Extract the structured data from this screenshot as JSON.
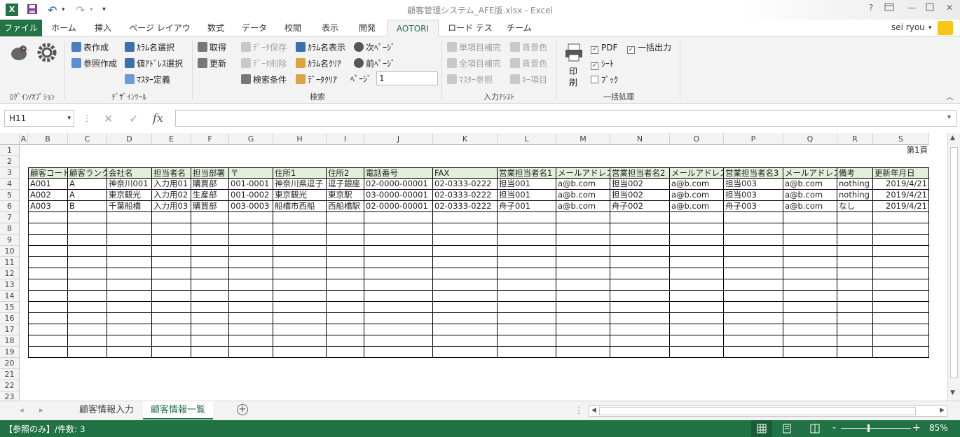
{
  "window": {
    "title": "顧客管理システム_AFE版.xlsx - Excel",
    "help": "?",
    "qat_more": "▾"
  },
  "tabs": [
    "ファイル",
    "ホーム",
    "挿入",
    "ページ レイアウト",
    "数式",
    "データ",
    "校閲",
    "表示",
    "開発",
    "AOTORI",
    "ロード テスト",
    "チーム"
  ],
  "user": "sei ryou",
  "ribbon": {
    "groups": {
      "login": "ﾛｸﾞｲﾝ/ｵﾌﾟｼｮﾝ",
      "design": "ﾃﾞｻﾞｲﾝﾂｰﾙ",
      "search": "検索",
      "assist": "入力ｱｼｽﾄ",
      "batch": "一括処理"
    },
    "design": [
      "表作成",
      "参照作成",
      "ｶﾗﾑ名選択",
      "値ｱﾄﾞﾚｽ選択",
      "ﾏｽﾀｰ定義"
    ],
    "search": [
      "取得",
      "更新",
      "ﾃﾞｰﾀ保存",
      "ﾃﾞｰﾀ削除",
      "検索条件",
      "ｶﾗﾑ名表示",
      "ｶﾗﾑ名ｸﾘｱ",
      "ﾃﾞｰﾀｸﾘｱ",
      "次ﾍﾟｰｼﾞ",
      "前ﾍﾟｰｼﾞ"
    ],
    "page_label": "ﾍﾟｰｼﾞ",
    "page_value": "1",
    "assist": [
      "単項目補完",
      "全項目補完",
      "ﾏｽﾀｰ参照",
      "背景色",
      "背景色",
      "ｷｰ項目"
    ],
    "batch": {
      "print": "印刷",
      "pdf": "PDF",
      "bulk": "一括出力",
      "sheet": "ｼｰﾄ",
      "book": "ﾌﾞｯｸ"
    }
  },
  "formula_bar": {
    "name_box": "H11",
    "fx": "fx",
    "value": ""
  },
  "columns": [
    "A",
    "B",
    "C",
    "D",
    "E",
    "F",
    "G",
    "H",
    "I",
    "J",
    "K",
    "L",
    "M",
    "N",
    "O",
    "P",
    "Q",
    "R",
    "S"
  ],
  "page_label_cell": "第1頁",
  "table": {
    "headers": [
      "顧客コード",
      "顧客ランク",
      "会社名",
      "担当者名",
      "担当部署",
      "〒",
      "住所1",
      "住所2",
      "電話番号",
      "FAX",
      "営業担当者名1",
      "メールアドレス1",
      "営業担当者名2",
      "メールアドレス2",
      "営業担当者名3",
      "メールアドレス3",
      "備考",
      "更新年月日"
    ],
    "rows": [
      [
        "A001",
        "A",
        "神奈川001",
        "入力用01",
        "購買部",
        "001-0001",
        "神奈川県逗子",
        "逗子銀座",
        "02-0000-00001",
        "02-0333-0222",
        "担当001",
        "a@b.com",
        "担当002",
        "a@b.com",
        "担当003",
        "a@b.com",
        "nothing",
        "2019/4/21"
      ],
      [
        "A002",
        "A",
        "東京観光",
        "入力用02",
        "生産部",
        "001-0002",
        "東京観光",
        "東京駅",
        "03-0000-00001",
        "02-0333-0222",
        "担当001",
        "a@b.com",
        "担当002",
        "a@b.com",
        "担当003",
        "a@b.com",
        "nothing",
        "2019/4/21"
      ],
      [
        "A003",
        "B",
        "千葉船橋",
        "入力用03",
        "購買部",
        "003-0003",
        "船橋市西船",
        "西船橋駅",
        "02-0000-00001",
        "02-0333-0222",
        "舟子001",
        "a@b.com",
        "舟子002",
        "a@b.com",
        "舟子003",
        "a@b.com",
        "なし",
        "2019/4/21"
      ]
    ]
  },
  "row_numbers": [
    "1",
    "2",
    "3",
    "4",
    "5",
    "6",
    "7",
    "8",
    "9",
    "10",
    "11",
    "12",
    "13",
    "14",
    "15",
    "16",
    "17",
    "18",
    "19",
    "20",
    "21",
    "22",
    "23"
  ],
  "sheets": [
    "顧客情報入力",
    "顧客情報一覧"
  ],
  "status": {
    "left": "【参照のみ】/件数: 3",
    "zoom": "85%",
    "minus": "-",
    "plus": "+"
  },
  "colors": {
    "excel_green": "#217346",
    "header_fill": "#e2efda"
  }
}
